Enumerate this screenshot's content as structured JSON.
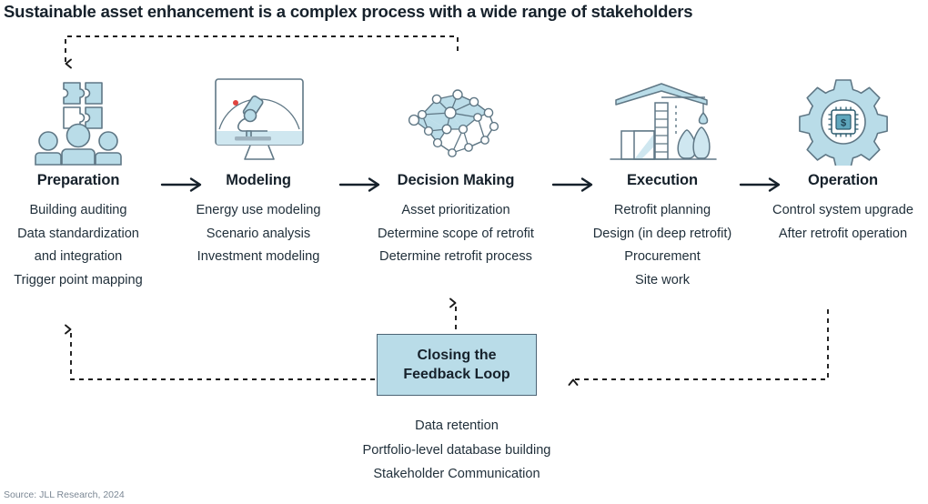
{
  "title": "Sustainable asset enhancement is a complex process with a wide range of stakeholders",
  "source": "Source: JLL Research, 2024",
  "colors": {
    "icon_fill": "#b9dce8",
    "icon_stroke": "#5f7785",
    "box_fill": "#b9dce8",
    "box_border": "#4c6475",
    "text": "#21303b",
    "heading": "#16212b",
    "arrow": "#16212b",
    "dashed": "#1b1b1b",
    "accent_red": "#e0443e",
    "source_text": "#7b8794"
  },
  "stages": [
    {
      "id": "preparation",
      "title": "Preparation",
      "icon": "people-puzzle-icon",
      "items": [
        "Building auditing",
        "Data standardization",
        "and integration",
        "Trigger point mapping"
      ]
    },
    {
      "id": "modeling",
      "title": "Modeling",
      "icon": "monitor-microscope-icon",
      "items": [
        "Energy use modeling",
        "Scenario analysis",
        "Investment modeling"
      ]
    },
    {
      "id": "decision-making",
      "title": "Decision Making",
      "icon": "brain-network-icon",
      "items": [
        "Asset prioritization",
        "Determine scope of retrofit",
        "Determine retrofit process"
      ]
    },
    {
      "id": "execution",
      "title": "Execution",
      "icon": "construction-crane-icon",
      "items": [
        "Retrofit planning",
        "Design (in deep retrofit)",
        "Procurement",
        "Site work"
      ]
    },
    {
      "id": "operation",
      "title": "Operation",
      "icon": "gear-chip-icon",
      "items": [
        "Control system upgrade",
        "After retrofit operation"
      ]
    }
  ],
  "connectors": {
    "solid_arrow_icon": "arrow-right-icon",
    "count": 4
  },
  "feedback": {
    "title_line1": "Closing the",
    "title_line2": "Feedback Loop",
    "items": [
      "Data retention",
      "Portfolio-level database building",
      "Stakeholder Communication"
    ]
  },
  "dashed_routes": [
    {
      "id": "operation-to-preparation-top",
      "label": "dashed-route-top"
    },
    {
      "id": "execution-to-feedback",
      "label": "dashed-route-right"
    },
    {
      "id": "feedback-to-decision-making",
      "label": "dashed-route-up"
    },
    {
      "id": "feedback-to-preparation",
      "label": "dashed-route-left"
    }
  ]
}
